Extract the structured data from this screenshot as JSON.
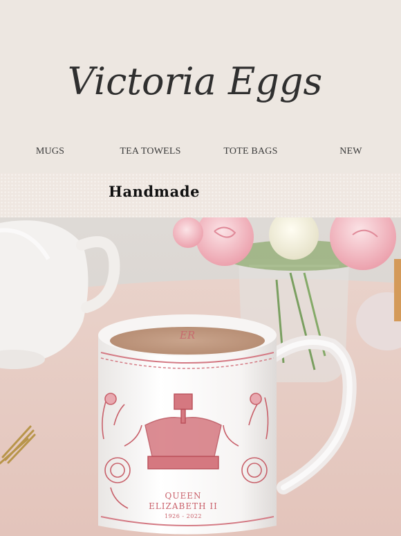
{
  "brand": {
    "name": "Victoria Eggs"
  },
  "nav": {
    "items": [
      {
        "label": "MUGS"
      },
      {
        "label": "TEA TOWELS"
      },
      {
        "label": "TOTE BAGS"
      },
      {
        "label": "NEW"
      }
    ]
  },
  "banner": {
    "title": "Handmade"
  },
  "hero": {
    "image_alt": "Queen Elizabeth II commemorative mug with tea",
    "mug_text": {
      "monogram": "ER",
      "line1": "QUEEN",
      "line2": "ELIZABETH II",
      "dates": "1926 - 2022"
    }
  },
  "colors": {
    "background": "#ede7e1",
    "print_red": "#c8606a",
    "tablecloth": "#e7cbc3"
  }
}
